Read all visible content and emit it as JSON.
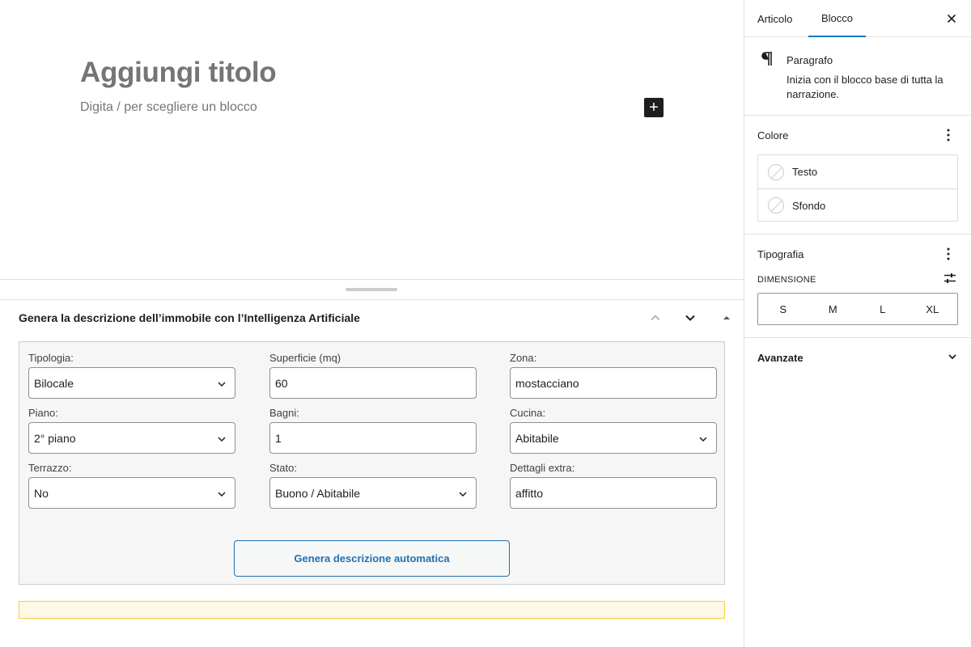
{
  "editor": {
    "title_placeholder": "Aggiungi titolo",
    "block_hint": "Digita / per scegliere un blocco",
    "inserter_glyph": "+"
  },
  "metabox": {
    "title": "Genera la descrizione dell’immobile con l’Intelligenza Artificiale",
    "fields": {
      "tipologia": {
        "label": "Tipologia:",
        "value": "Bilocale"
      },
      "superficie": {
        "label": "Superficie (mq)",
        "value": "60"
      },
      "zona": {
        "label": "Zona:",
        "value": "mostacciano"
      },
      "piano": {
        "label": "Piano:",
        "value": "2° piano"
      },
      "bagni": {
        "label": "Bagni:",
        "value": "1"
      },
      "cucina": {
        "label": "Cucina:",
        "value": "Abitabile"
      },
      "terrazzo": {
        "label": "Terrazzo:",
        "value": "No"
      },
      "stato": {
        "label": "Stato:",
        "value": "Buono / Abitabile"
      },
      "dettagli": {
        "label": "Dettagli extra:",
        "value": "affitto"
      }
    },
    "generate_button": "Genera descrizione automatica"
  },
  "sidebar": {
    "tabs": [
      "Articolo",
      "Blocco"
    ],
    "active_tab": "Blocco",
    "block": {
      "name": "Paragrafo",
      "description": "Inizia con il blocco base di tutta la narrazione."
    },
    "color_panel": {
      "title": "Colore",
      "items": [
        "Testo",
        "Sfondo"
      ]
    },
    "typography_panel": {
      "title": "Tipografia",
      "size_label": "DIMENSIONE",
      "sizes": [
        "S",
        "M",
        "L",
        "XL"
      ]
    },
    "advanced_panel": {
      "title": "Avanzate"
    }
  },
  "colors": {
    "accent": "#007cba",
    "button_blue": "#2271b1",
    "notice_yellow": "#f0d23c"
  }
}
